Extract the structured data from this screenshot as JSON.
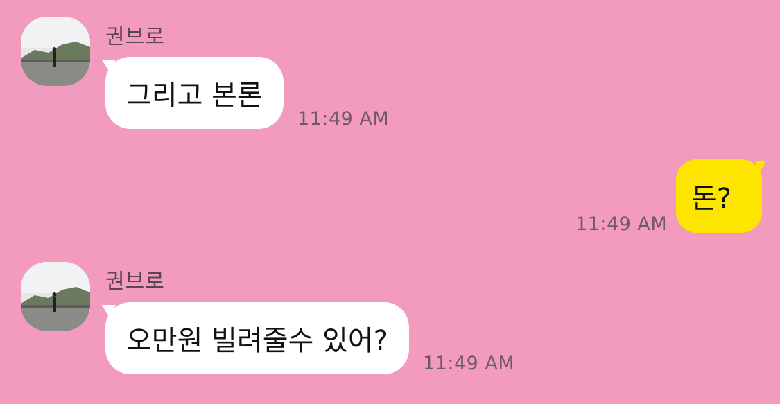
{
  "colors": {
    "background": "#F29BBF",
    "incoming_bubble": "#FFFFFF",
    "outgoing_bubble": "#FEE500"
  },
  "messages": [
    {
      "direction": "incoming",
      "sender": "권브로",
      "text": "그리고 본론",
      "time": "11:49 AM",
      "avatar_icon": "profile-photo"
    },
    {
      "direction": "outgoing",
      "text": "돈?",
      "time": "11:49 AM"
    },
    {
      "direction": "incoming",
      "sender": "권브로",
      "text": "오만원 빌려줄수 있어?",
      "time": "11:49 AM",
      "avatar_icon": "profile-photo"
    }
  ]
}
